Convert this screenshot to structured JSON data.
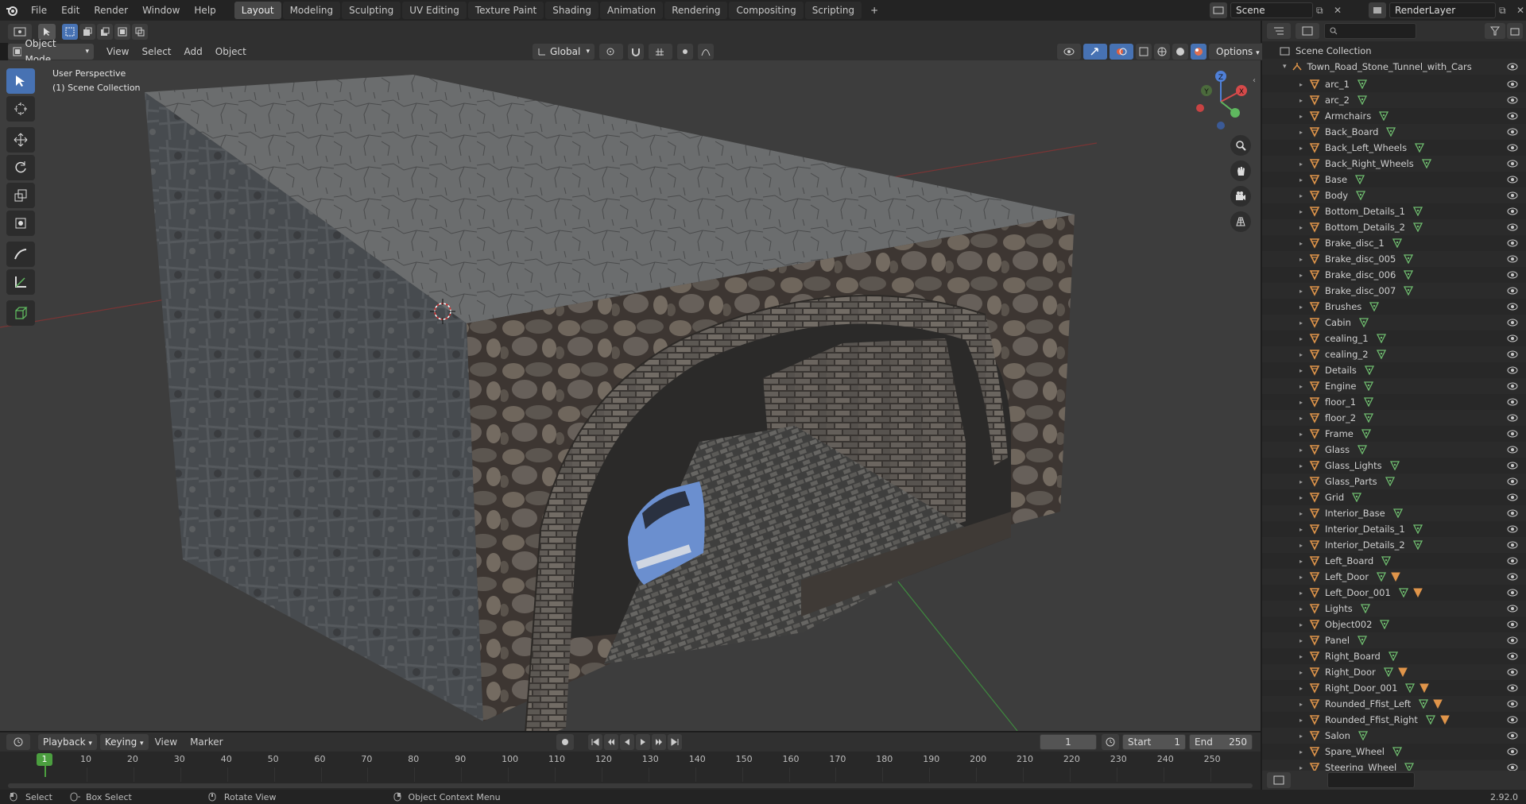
{
  "top_menu": {
    "items": [
      "File",
      "Edit",
      "Render",
      "Window",
      "Help"
    ],
    "tabs": [
      "Layout",
      "Modeling",
      "Sculpting",
      "UV Editing",
      "Texture Paint",
      "Shading",
      "Animation",
      "Rendering",
      "Compositing",
      "Scripting"
    ],
    "active_tab": "Layout",
    "add_tab": "+",
    "scene_name": "Scene",
    "render_layer": "RenderLayer"
  },
  "viewport_header": {
    "mode": "Object Mode",
    "menus": [
      "View",
      "Select",
      "Add",
      "Object"
    ],
    "transform_orientation": "Global",
    "options": "Options"
  },
  "viewport": {
    "perspective": "User Perspective",
    "collection": "(1) Scene Collection"
  },
  "gizmo": {
    "x": "X",
    "y": "Y",
    "z": "Z"
  },
  "outliner": {
    "root": "Scene Collection",
    "collection": "Town_Road_Stone_Tunnel_with_Cars",
    "objects": [
      {
        "name": "arc_1",
        "material": false
      },
      {
        "name": "arc_2",
        "material": false
      },
      {
        "name": "Armchairs",
        "material": false
      },
      {
        "name": "Back_Board",
        "material": false
      },
      {
        "name": "Back_Left_Wheels",
        "material": false
      },
      {
        "name": "Back_Right_Wheels",
        "material": false
      },
      {
        "name": "Base",
        "material": false
      },
      {
        "name": "Body",
        "material": false
      },
      {
        "name": "Bottom_Details_1",
        "material": false
      },
      {
        "name": "Bottom_Details_2",
        "material": false
      },
      {
        "name": "Brake_disc_1",
        "material": false
      },
      {
        "name": "Brake_disc_005",
        "material": false
      },
      {
        "name": "Brake_disc_006",
        "material": false
      },
      {
        "name": "Brake_disc_007",
        "material": false
      },
      {
        "name": "Brushes",
        "material": false
      },
      {
        "name": "Cabin",
        "material": false
      },
      {
        "name": "cealing_1",
        "material": false
      },
      {
        "name": "cealing_2",
        "material": false
      },
      {
        "name": "Details",
        "material": false
      },
      {
        "name": "Engine",
        "material": false
      },
      {
        "name": "floor_1",
        "material": false
      },
      {
        "name": "floor_2",
        "material": false
      },
      {
        "name": "Frame",
        "material": false
      },
      {
        "name": "Glass",
        "material": false
      },
      {
        "name": "Glass_Lights",
        "material": false
      },
      {
        "name": "Glass_Parts",
        "material": false
      },
      {
        "name": "Grid",
        "material": false
      },
      {
        "name": "Interior_Base",
        "material": false
      },
      {
        "name": "Interior_Details_1",
        "material": false
      },
      {
        "name": "Interior_Details_2",
        "material": false
      },
      {
        "name": "Left_Board",
        "material": false
      },
      {
        "name": "Left_Door",
        "material": true
      },
      {
        "name": "Left_Door_001",
        "material": true
      },
      {
        "name": "Lights",
        "material": false
      },
      {
        "name": "Object002",
        "material": false
      },
      {
        "name": "Panel",
        "material": false
      },
      {
        "name": "Right_Board",
        "material": false
      },
      {
        "name": "Right_Door",
        "material": true
      },
      {
        "name": "Right_Door_001",
        "material": true
      },
      {
        "name": "Rounded_Ffist_Left",
        "material": true
      },
      {
        "name": "Rounded_Ffist_Right",
        "material": true
      },
      {
        "name": "Salon",
        "material": false
      },
      {
        "name": "Spare_Wheel",
        "material": false
      },
      {
        "name": "Steering_Wheel",
        "material": false
      }
    ]
  },
  "timeline": {
    "menus": [
      "Playback",
      "Keying",
      "View",
      "Marker"
    ],
    "current_frame": "1",
    "start_label": "Start",
    "start": "1",
    "end_label": "End",
    "end": "250",
    "ticks": [
      "10",
      "20",
      "30",
      "40",
      "50",
      "60",
      "70",
      "80",
      "90",
      "100",
      "110",
      "120",
      "130",
      "140",
      "150",
      "160",
      "170",
      "180",
      "190",
      "200",
      "210",
      "220",
      "230",
      "240",
      "250"
    ],
    "playhead": "1"
  },
  "status": {
    "select": "Select",
    "box_select": "Box Select",
    "rotate": "Rotate View",
    "context": "Object Context Menu",
    "version": "2.92.0"
  }
}
